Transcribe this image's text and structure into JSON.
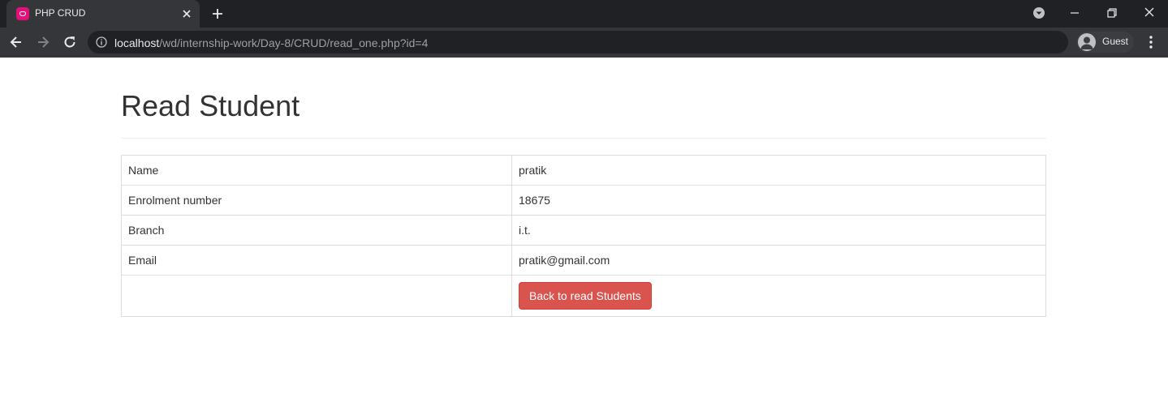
{
  "browser": {
    "tab_title": "PHP CRUD",
    "url_host": "localhost",
    "url_path": "/wd/internship-work/Day-8/CRUD/read_one.php?id=4",
    "profile_label": "Guest"
  },
  "page": {
    "heading": "Read Student",
    "rows": [
      {
        "label": "Name",
        "value": "pratik"
      },
      {
        "label": "Enrolment number",
        "value": "18675"
      },
      {
        "label": "Branch",
        "value": "i.t."
      },
      {
        "label": "Email",
        "value": "pratik@gmail.com"
      }
    ],
    "back_button_label": "Back to read Students"
  },
  "colors": {
    "button_danger": "#d9534f",
    "tab_favicon": "#e3107a",
    "chrome_dark": "#202124",
    "chrome_tab": "#35363a"
  }
}
